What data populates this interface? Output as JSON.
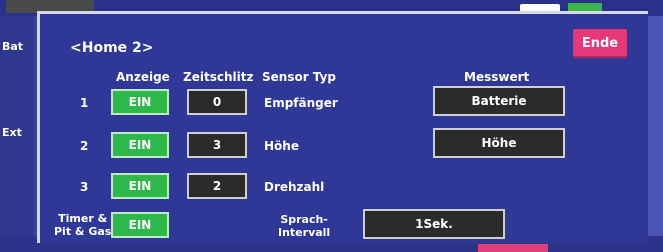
{
  "background": {
    "labels": [
      "Bat",
      "Ext"
    ]
  },
  "dialog": {
    "title": "<Home 2>",
    "close_label": "Ende",
    "headers": {
      "display": "Anzeige",
      "timeslot": "Zeitschlitz",
      "sensor_type": "Sensor Typ",
      "measured_value": "Messwert"
    },
    "rows": [
      {
        "num": "1",
        "display": "EIN",
        "slot": "0",
        "sensor": "Empfänger",
        "value": "Batterie"
      },
      {
        "num": "2",
        "display": "EIN",
        "slot": "3",
        "sensor": "Höhe",
        "value": "Höhe"
      },
      {
        "num": "3",
        "display": "EIN",
        "slot": "2",
        "sensor": "Drehzahl"
      }
    ],
    "timer": {
      "label_line1": "Timer &",
      "label_line2": "Pit & Gas",
      "display": "EIN"
    },
    "speech": {
      "label_line1": "Sprach-",
      "label_line2": "Intervall",
      "value": "1Sek."
    }
  },
  "colors": {
    "background": "#3a43a0",
    "dialog": "#2f3896",
    "on_button": "#2fb84a",
    "close_button": "#e4387a",
    "value_button": "#2b2b2b"
  }
}
